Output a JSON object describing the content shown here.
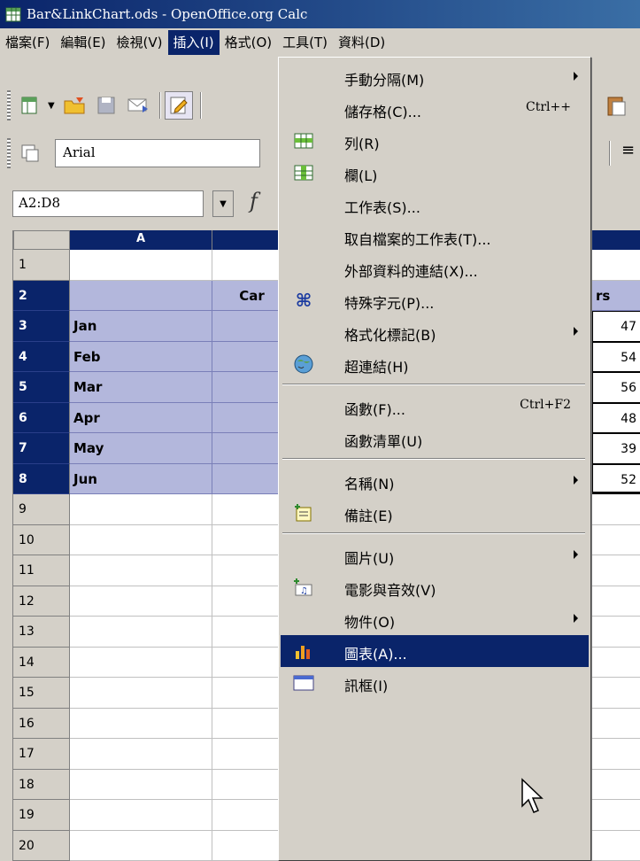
{
  "window": {
    "title": "Bar&LinkChart.ods - OpenOffice.org Calc"
  },
  "menubar": {
    "items": [
      {
        "label": "檔案(F)"
      },
      {
        "label": "編輯(E)"
      },
      {
        "label": "檢視(V)"
      },
      {
        "label": "插入(I)"
      },
      {
        "label": "格式(O)"
      },
      {
        "label": "工具(T)"
      },
      {
        "label": "資料(D)"
      }
    ]
  },
  "toolbar": {
    "font_name": "Arial"
  },
  "namebox": {
    "value": "A2:D8"
  },
  "grid": {
    "col_headers": [
      "A",
      ""
    ],
    "row_numbers": [
      "1",
      "2",
      "3",
      "4",
      "5",
      "6",
      "7",
      "8",
      "9",
      "10",
      "11",
      "12",
      "13",
      "14",
      "15",
      "16",
      "17",
      "18",
      "19",
      "20"
    ],
    "partial_header_b2": "Car",
    "partial_header_d2": "rs",
    "months": [
      "Jan",
      "Feb",
      "Mar",
      "Apr",
      "May",
      "Jun"
    ],
    "d_values": [
      "47",
      "54",
      "56",
      "48",
      "39",
      "52"
    ]
  },
  "insert_menu": {
    "items": [
      {
        "label": "手動分隔(M)",
        "shortcut": "",
        "submenu": true,
        "icon": ""
      },
      {
        "label": "儲存格(C)...",
        "shortcut": "Ctrl++",
        "submenu": false,
        "icon": ""
      },
      {
        "label": "列(R)",
        "shortcut": "",
        "submenu": false,
        "icon": "insert-rows-icon"
      },
      {
        "label": "欄(L)",
        "shortcut": "",
        "submenu": false,
        "icon": "insert-columns-icon"
      },
      {
        "label": "工作表(S)...",
        "shortcut": "",
        "submenu": false,
        "icon": ""
      },
      {
        "label": "取自檔案的工作表(T)...",
        "shortcut": "",
        "submenu": false,
        "icon": ""
      },
      {
        "label": "外部資料的連結(X)...",
        "shortcut": "",
        "submenu": false,
        "icon": ""
      },
      {
        "label": "特殊字元(P)...",
        "shortcut": "",
        "submenu": false,
        "icon": "special-character-icon"
      },
      {
        "label": "格式化標記(B)",
        "shortcut": "",
        "submenu": true,
        "icon": ""
      },
      {
        "label": "超連結(H)",
        "shortcut": "",
        "submenu": false,
        "icon": "hyperlink-icon"
      },
      {
        "label": "函數(F)...",
        "shortcut": "Ctrl+F2",
        "submenu": false,
        "icon": ""
      },
      {
        "label": "函數清單(U)",
        "shortcut": "",
        "submenu": false,
        "icon": ""
      },
      {
        "label": "名稱(N)",
        "shortcut": "",
        "submenu": true,
        "icon": ""
      },
      {
        "label": "備註(E)",
        "shortcut": "",
        "submenu": false,
        "icon": "comment-icon"
      },
      {
        "label": "圖片(U)",
        "shortcut": "",
        "submenu": true,
        "icon": ""
      },
      {
        "label": "電影與音效(V)",
        "shortcut": "",
        "submenu": false,
        "icon": "movie-sound-icon"
      },
      {
        "label": "物件(O)",
        "shortcut": "",
        "submenu": true,
        "icon": ""
      },
      {
        "label": "圖表(A)...",
        "shortcut": "",
        "submenu": false,
        "icon": "chart-icon",
        "highlighted": true
      },
      {
        "label": "訊框(I)",
        "shortcut": "",
        "submenu": false,
        "icon": "frame-icon"
      }
    ]
  },
  "colors": {
    "selection": "#0a246a",
    "selected_cell": "#b3b7dc",
    "face": "#d4d0c8"
  }
}
